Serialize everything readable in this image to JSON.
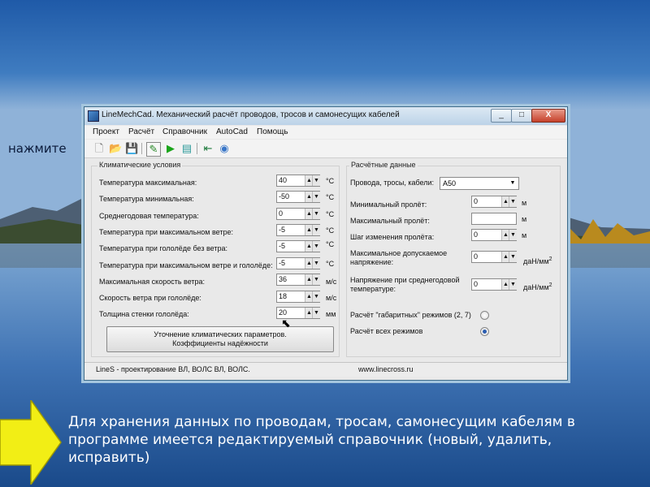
{
  "hint": "нажмите",
  "window": {
    "title": "LineMechCad. Механический расчёт проводов, тросов и самонесущих кабелей",
    "controls": [
      "_",
      "□",
      "X"
    ]
  },
  "menu": [
    "Проект",
    "Расчёт",
    "Справочник",
    "AutoCad",
    "Помощь"
  ],
  "toolbar": [
    {
      "name": "new-icon",
      "glyph": "🗋"
    },
    {
      "name": "open-icon",
      "glyph": "📂"
    },
    {
      "name": "save-icon",
      "glyph": "💾"
    },
    {
      "name": "edit-icon",
      "glyph": "✎"
    },
    {
      "name": "run-icon",
      "glyph": "▶"
    },
    {
      "name": "chart-icon",
      "glyph": "▤"
    },
    {
      "name": "export-icon",
      "glyph": "⇤"
    },
    {
      "name": "help-icon",
      "glyph": "◉"
    }
  ],
  "climate": {
    "title": "Климатические условия",
    "rows": [
      {
        "label": "Температура максимальная:",
        "value": "40",
        "unit": "°С"
      },
      {
        "label": "Температура минимальная:",
        "value": "-50",
        "unit": "°С"
      },
      {
        "label": "Среднегодовая температура:",
        "value": "0",
        "unit": "°С"
      },
      {
        "label": "Температура при максимальном ветре:",
        "value": "-5",
        "unit": "°С"
      },
      {
        "label": "Температура при гололёде без ветра:",
        "value": "-5",
        "unit": "°С"
      },
      {
        "label": "Температура при максимальном ветре и гололёде:",
        "value": "-5",
        "unit": "°С"
      },
      {
        "label": "Максимальная скорость ветра:",
        "value": "36",
        "unit": "м/с"
      },
      {
        "label": "Скорость ветра при гололёде:",
        "value": "18",
        "unit": "м/с"
      },
      {
        "label": "Толщина стенки гололёда:",
        "value": "20",
        "unit": "мм"
      }
    ],
    "button_line1": "Уточнение климатических параметров.",
    "button_line2": "Коэффициенты надёжности"
  },
  "calc": {
    "title": "Расчётные данные",
    "wire_label": "Провода, тросы, кабели:",
    "wire_value": "А50",
    "min_span_label": "Минимальный пролёт:",
    "min_span_value": "0",
    "min_span_unit": "м",
    "max_span_label": "Максимальный пролёт:",
    "max_span_value": "",
    "max_span_unit": "м",
    "step_label": "Шаг изменения пролёта:",
    "step_value": "0",
    "step_unit": "м",
    "max_stress_label1": "Максимальное допускаемое",
    "max_stress_label2": "напряжение:",
    "max_stress_value": "0",
    "max_stress_unit": "даН/мм",
    "avg_stress_label1": "Напряжение при среднегодовой",
    "avg_stress_label2": "температуре:",
    "avg_stress_value": "0",
    "avg_stress_unit": "даН/мм",
    "unit_sup": "2",
    "radio1_label": "Расчёт \"габаритных\" режимов (2, 7)",
    "radio2_label": "Расчёт всех режимов"
  },
  "status": {
    "left": "LineS - проектирование ВЛ, ВОЛС ВЛ, ВОЛС.",
    "right": "www.linecross.ru"
  },
  "note": "Для хранения данных по проводам, тросам, самонесущим кабелям в программе имеется редактируемый справочник (новый, удалить, исправить)"
}
